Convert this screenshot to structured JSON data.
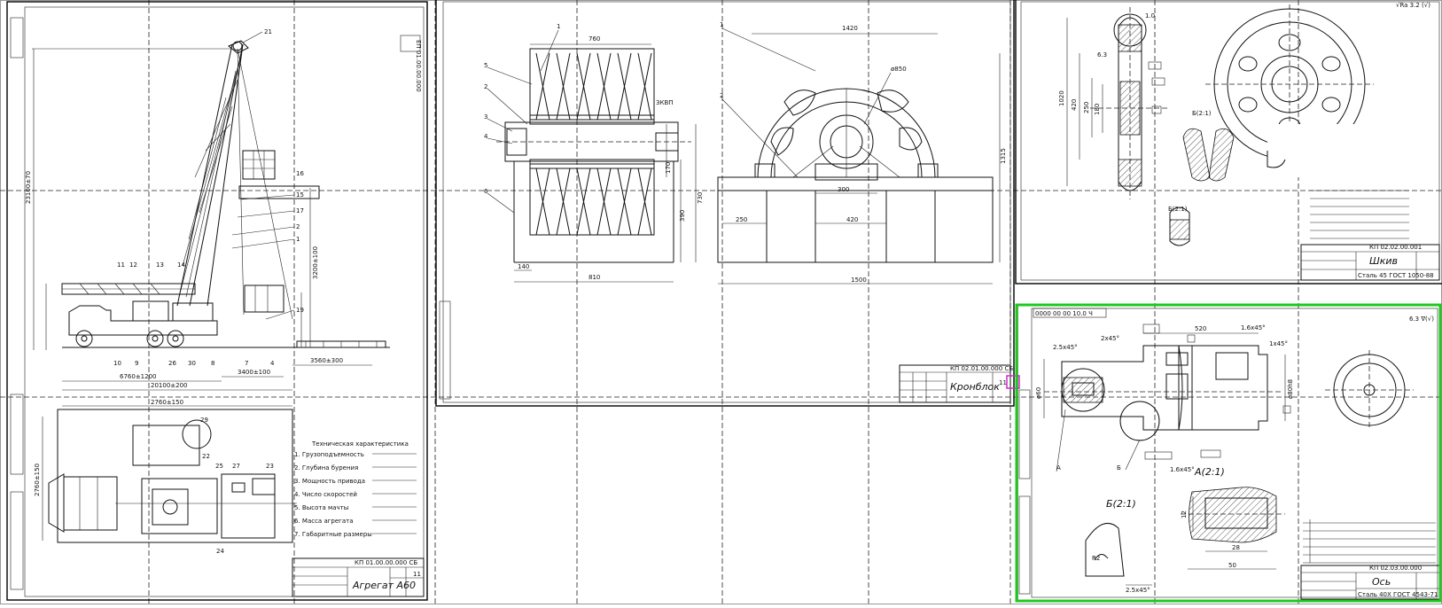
{
  "sheets": {
    "aggregate": {
      "title": "Агрегат А60",
      "doc_code": "КП 01.00.00.000 СБ",
      "sheet_no": "11",
      "spec_heading": "Техническая характеристика",
      "callouts": [
        "21",
        "16",
        "15",
        "17",
        "2",
        "1",
        "19",
        "11",
        "12",
        "13",
        "14",
        "10",
        "9",
        "26",
        "30",
        "8",
        "7",
        "4",
        "29",
        "22",
        "25",
        "27",
        "23",
        "24"
      ],
      "spec_items": [
        "1. Грузоподъемность",
        "2. Глубина бурения",
        "3. Мощность привода",
        "4. Число скоростей",
        "5. Высота мачты",
        "6. Масса агрегата",
        "7. Габаритные размеры"
      ]
    },
    "crown_block": {
      "title": "Кронблок",
      "doc_code": "КП 02.01.00.000 СБ",
      "sheet_no": "11"
    },
    "pulley": {
      "title": "Шкив",
      "doc_code": "КП 02.02.00.001",
      "material": "Сталь 45 ГОСТ 1050-88",
      "roughness": "√Ra 3.2 (√)"
    },
    "shaft": {
      "title": "Ось",
      "doc_code": "КП 02.03.00.000",
      "material": "Сталь 40Х ГОСТ 4543-71",
      "stamp_code": "0000 00 00 10.0 Ч",
      "roughness": "6.3 ∇(√)",
      "view_a": "А(2:1)",
      "view_b": "Б(2:1)",
      "marker_a": "А",
      "marker_b": "Б"
    }
  },
  "colors": {
    "selection": "#1ec81e",
    "highlight": "#d12ad1",
    "line": "#111111"
  }
}
